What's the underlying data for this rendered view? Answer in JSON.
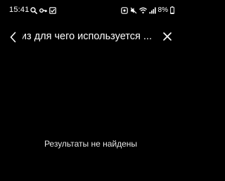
{
  "status_bar": {
    "time": "15:41",
    "left_icons": [
      "search-icon",
      "key-icon",
      "check-box-icon"
    ],
    "right_icons": [
      "cast-icon",
      "mute-icon",
      "wifi-icon",
      "signal-icon"
    ],
    "battery_text": "8%"
  },
  "search": {
    "query": "из для чего используется ...",
    "back_icon": "chevron-left-icon",
    "clear_icon": "close-icon"
  },
  "results": {
    "empty_text": "Результаты не найдены"
  }
}
